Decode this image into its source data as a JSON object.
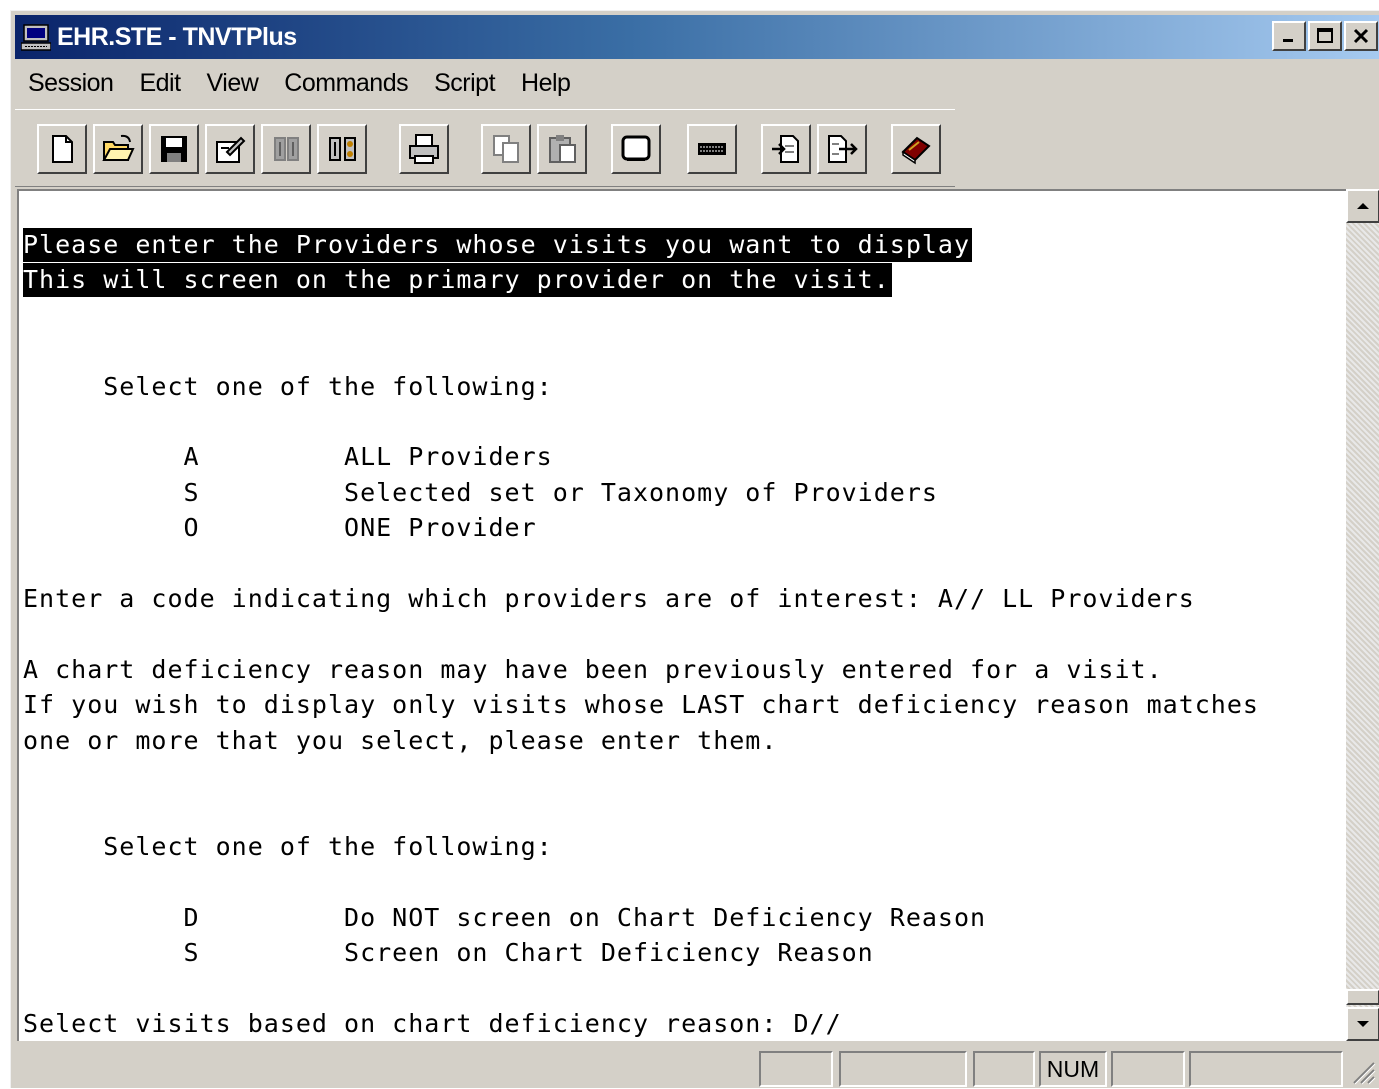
{
  "window": {
    "title": "EHR.STE - TNVTPlus",
    "controls": [
      "minimize",
      "maximize",
      "close"
    ]
  },
  "menu": {
    "items": [
      "Session",
      "Edit",
      "View",
      "Commands",
      "Script",
      "Help"
    ]
  },
  "toolbar": {
    "buttons": [
      "new-icon",
      "open-icon",
      "save-icon",
      "properties-icon",
      "connect-icon",
      "disconnect-icon",
      "print-icon",
      "copy-icon",
      "paste-icon",
      "screen-icon",
      "keyboard-icon",
      "receive-file-icon",
      "send-file-icon",
      "help-book-icon"
    ]
  },
  "terminal": {
    "lines": [
      {
        "text": "Please enter the Providers whose visits you want to display",
        "inverse": true
      },
      {
        "text": "This will screen on the primary provider on the visit.",
        "inverse": true
      },
      {
        "text": "",
        "inverse": false
      },
      {
        "text": "",
        "inverse": false
      },
      {
        "text": "     Select one of the following:",
        "inverse": false
      },
      {
        "text": "",
        "inverse": false
      },
      {
        "text": "          A         ALL Providers",
        "inverse": false
      },
      {
        "text": "          S         Selected set or Taxonomy of Providers",
        "inverse": false
      },
      {
        "text": "          O         ONE Provider",
        "inverse": false
      },
      {
        "text": "",
        "inverse": false
      },
      {
        "text": "Enter a code indicating which providers are of interest: A// LL Providers",
        "inverse": false
      },
      {
        "text": "",
        "inverse": false
      },
      {
        "text": "A chart deficiency reason may have been previously entered for a visit.",
        "inverse": false
      },
      {
        "text": "If you wish to display only visits whose LAST chart deficiency reason matches",
        "inverse": false
      },
      {
        "text": "one or more that you select, please enter them.",
        "inverse": false
      },
      {
        "text": "",
        "inverse": false
      },
      {
        "text": "",
        "inverse": false
      },
      {
        "text": "     Select one of the following:",
        "inverse": false
      },
      {
        "text": "",
        "inverse": false
      },
      {
        "text": "          D         Do NOT screen on Chart Deficiency Reason",
        "inverse": false
      },
      {
        "text": "          S         Screen on Chart Deficiency Reason",
        "inverse": false
      },
      {
        "text": "",
        "inverse": false
      },
      {
        "text": "Select visits based on chart deficiency reason: D//",
        "inverse": false
      }
    ]
  },
  "statusbar": {
    "panes": [
      "",
      "",
      "",
      "NUM",
      "",
      ""
    ]
  }
}
